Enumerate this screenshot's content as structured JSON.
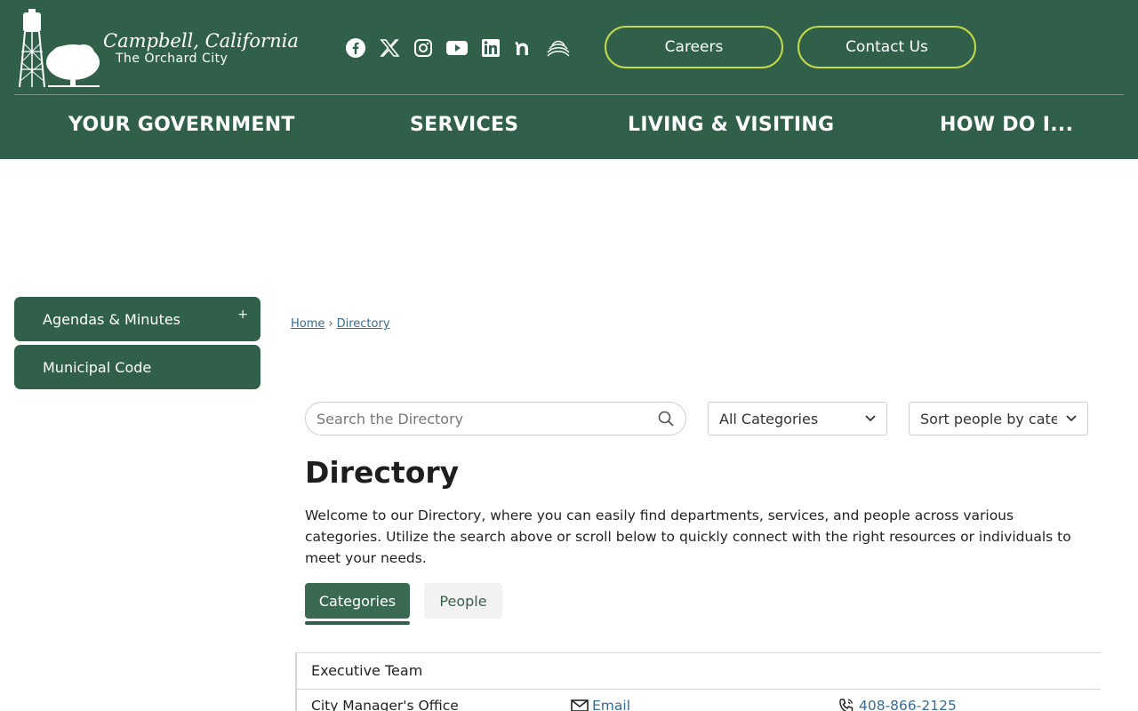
{
  "site": {
    "logo_line1": "Campbell, California",
    "logo_line2": "The Orchard City"
  },
  "social": [
    "facebook-icon",
    "x-icon",
    "instagram-icon",
    "youtube-icon",
    "linkedin-icon",
    "nextdoor-icon",
    "wave-icon"
  ],
  "header_buttons": {
    "careers": "Careers",
    "contact": "Contact Us"
  },
  "nav": {
    "government": "YOUR GOVERNMENT",
    "services": "SERVICES",
    "living": "LIVING & VISITING",
    "howdoi": "HOW DO I..."
  },
  "sidebar": {
    "items": [
      {
        "label": "Agendas & Minutes",
        "expand": "+"
      },
      {
        "label": "Municipal Code"
      }
    ]
  },
  "breadcrumb": {
    "home": "Home",
    "separator": "›",
    "current": "Directory"
  },
  "filters": {
    "search_placeholder": "Search the Directory",
    "category_selected": "All Categories",
    "sort_selected": "Sort people by category"
  },
  "main": {
    "title": "Directory",
    "intro": "Welcome to our Directory, where you can easily find departments, services, and people across various categories. Utilize the search above or scroll below to quickly connect with the right resources or individuals to meet your needs.",
    "tabs": [
      {
        "label": "Categories",
        "active": true
      },
      {
        "label": "People",
        "active": false
      }
    ]
  },
  "table": {
    "group": "Executive Team",
    "rows": [
      {
        "name": "City Manager's Office",
        "email": "Email",
        "phone": "408-866-2125"
      }
    ]
  },
  "colors": {
    "brand_green": "#30604a",
    "accent_lime": "#c4d94b",
    "link_blue": "#3a6a8f"
  }
}
